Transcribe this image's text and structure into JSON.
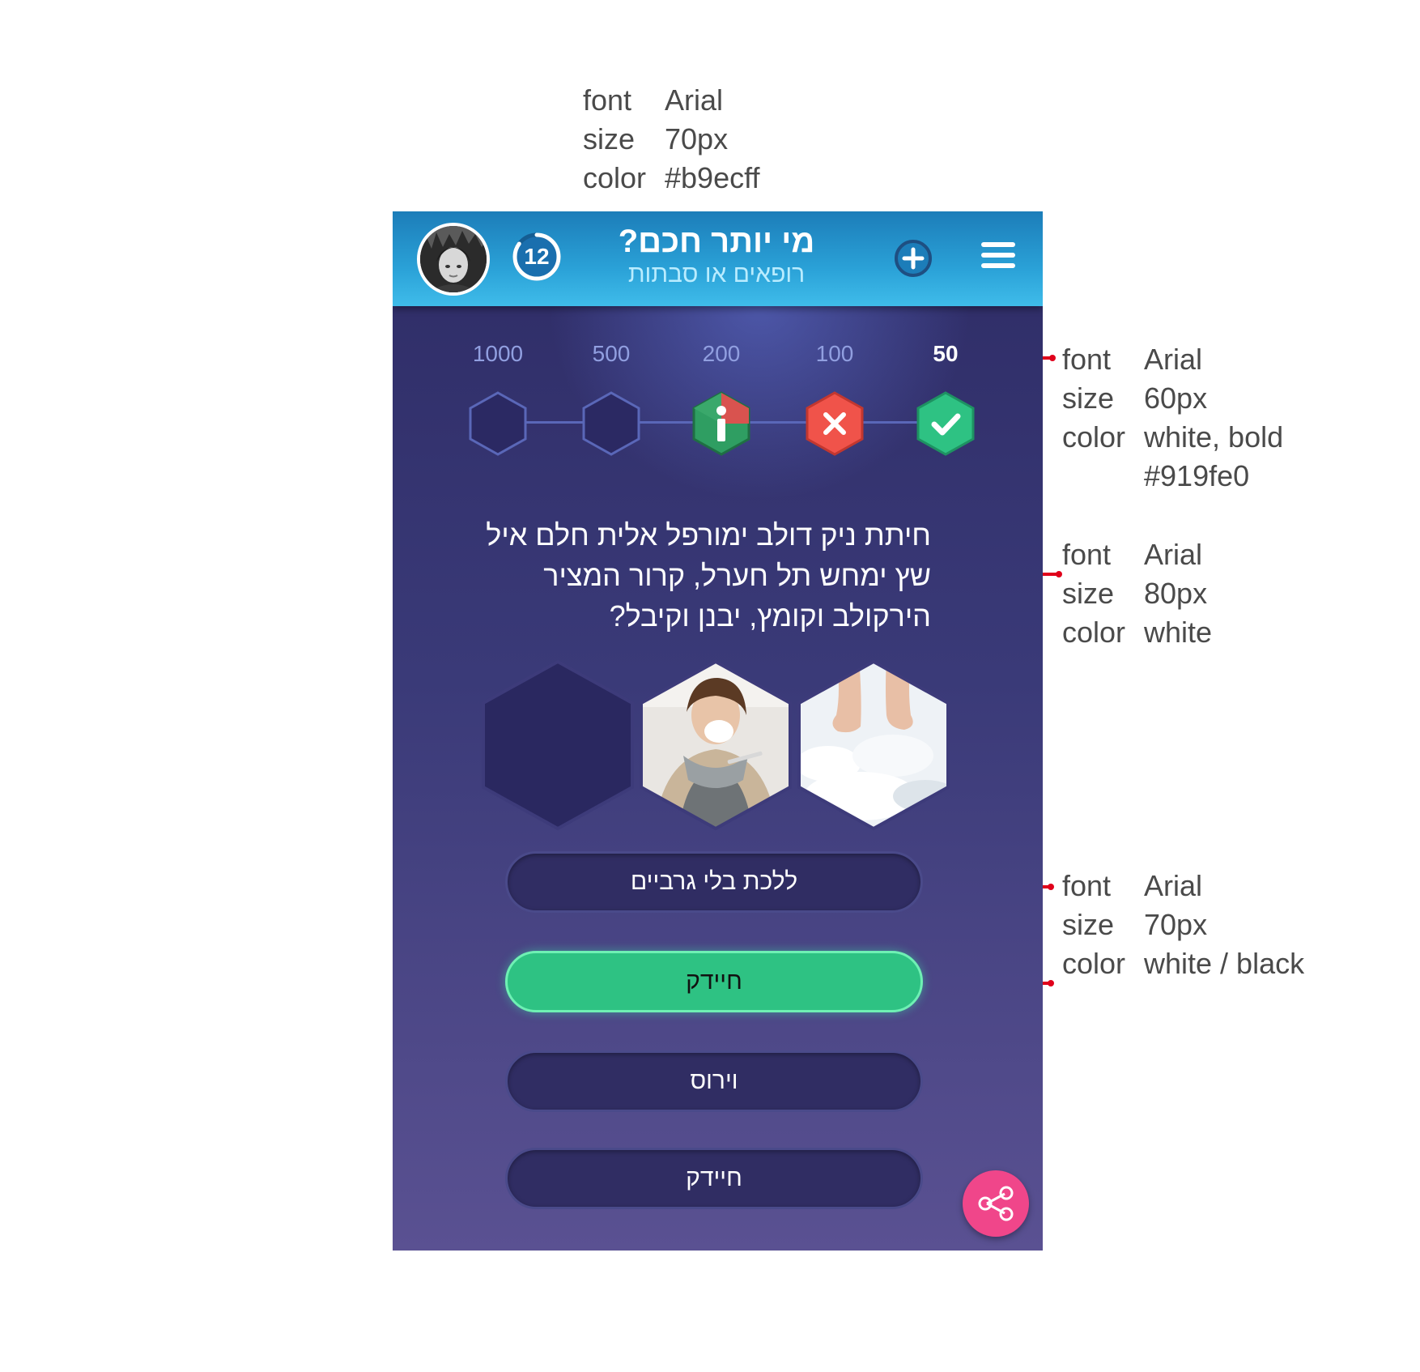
{
  "specs": {
    "title": {
      "font": "Arial",
      "size": "70px",
      "color": "#b9ecff"
    },
    "levels": {
      "font": "Arial",
      "size": "60px",
      "color": "white, bold",
      "color2": "#919fe0"
    },
    "question": {
      "font": "Arial",
      "size": "80px",
      "color": "white"
    },
    "answers": {
      "font": "Arial",
      "size": "70px",
      "color": "white / black"
    },
    "labels": {
      "font": "font",
      "size": "size",
      "color": "color"
    }
  },
  "header": {
    "title": "מי יותר חכם?",
    "subtitle": "רופאים או סבתות",
    "timer": "12",
    "timer_progress": 0.85
  },
  "levels": [
    {
      "value": "1000",
      "state": "empty"
    },
    {
      "value": "500",
      "state": "empty"
    },
    {
      "value": "200",
      "state": "info"
    },
    {
      "value": "100",
      "state": "wrong"
    },
    {
      "value": "50",
      "state": "correct"
    }
  ],
  "question": "חיתת ניק דולב ימורפל אלית חלם איל שץ ימחש תל חערל, קרור המציר הירקולב וקומץ, יבנן וקיבל?",
  "answers": [
    {
      "label": "ללכת בלי גרביים",
      "state": "normal"
    },
    {
      "label": "חיידק",
      "state": "correct"
    },
    {
      "label": "וירוס",
      "state": "normal"
    },
    {
      "label": "חיידק",
      "state": "normal"
    }
  ],
  "images": [
    "empty-hex",
    "sneezing-woman-photo",
    "bare-feet-in-snow-photo"
  ],
  "colors": {
    "header_top": "#1c7db9",
    "header_bottom": "#3fbcea",
    "subtitle": "#b9ecff",
    "level_inactive": "#919fe0",
    "correct": "#2ec283",
    "wrong": "#f0534a",
    "share": "#f0468a",
    "leader": "#e0001b"
  }
}
